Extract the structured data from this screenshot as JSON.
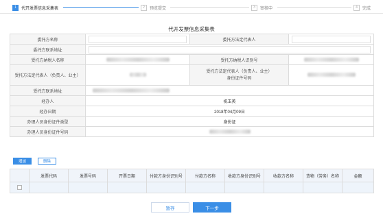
{
  "stepper": {
    "steps": [
      {
        "num": "1",
        "label": "代开发票信息采集表"
      },
      {
        "num": "2",
        "label": "预览提交"
      },
      {
        "num": "3",
        "label": "审核中"
      },
      {
        "num": "4",
        "label": "完成"
      }
    ],
    "active_index": 0
  },
  "form": {
    "title": "代开发票信息采集表",
    "labels": {
      "entrustor_name": "委托方名称",
      "entrustor_legal_rep": "委托方法定代表人",
      "entrustor_contact_addr": "委托方联系地址",
      "trustee_taxpayer_name": "受托方纳税人名称",
      "trustee_taxpayer_id": "受托方纳税人识别号",
      "trustee_legal_rep": "受托方法定代表人（负责人、业主）",
      "trustee_legal_rep_2": "受托方法定代表人（负责人、业主）",
      "trustee_id_number": "身份证件号码",
      "trustee_contact_addr": "受托方联系地址",
      "handler": "经办人",
      "handle_date": "经办日期",
      "handler_id_type": "办理人员身份证件类型",
      "handler_id_number": "办理人员身份证件号码"
    },
    "values": {
      "handler": "祝玉英",
      "handle_date": "2018年04月09日",
      "handler_id_type": "身份证"
    }
  },
  "actions": {
    "add_label": "增加",
    "delete_label": "删除"
  },
  "invoice_table": {
    "columns": [
      "发票代码",
      "发票号码",
      "开票日期",
      "付款方身份识别号",
      "付款方名称",
      "收款方身份识别号",
      "收款方名称",
      "货物（劳务）名称",
      "金额"
    ]
  },
  "footer": {
    "save_label": "暂存",
    "next_label": "下一步"
  },
  "colors": {
    "accent": "#3a8ee6",
    "label_bg": "#f5f5f5",
    "grid_header_bg": "#f0f4fa"
  }
}
